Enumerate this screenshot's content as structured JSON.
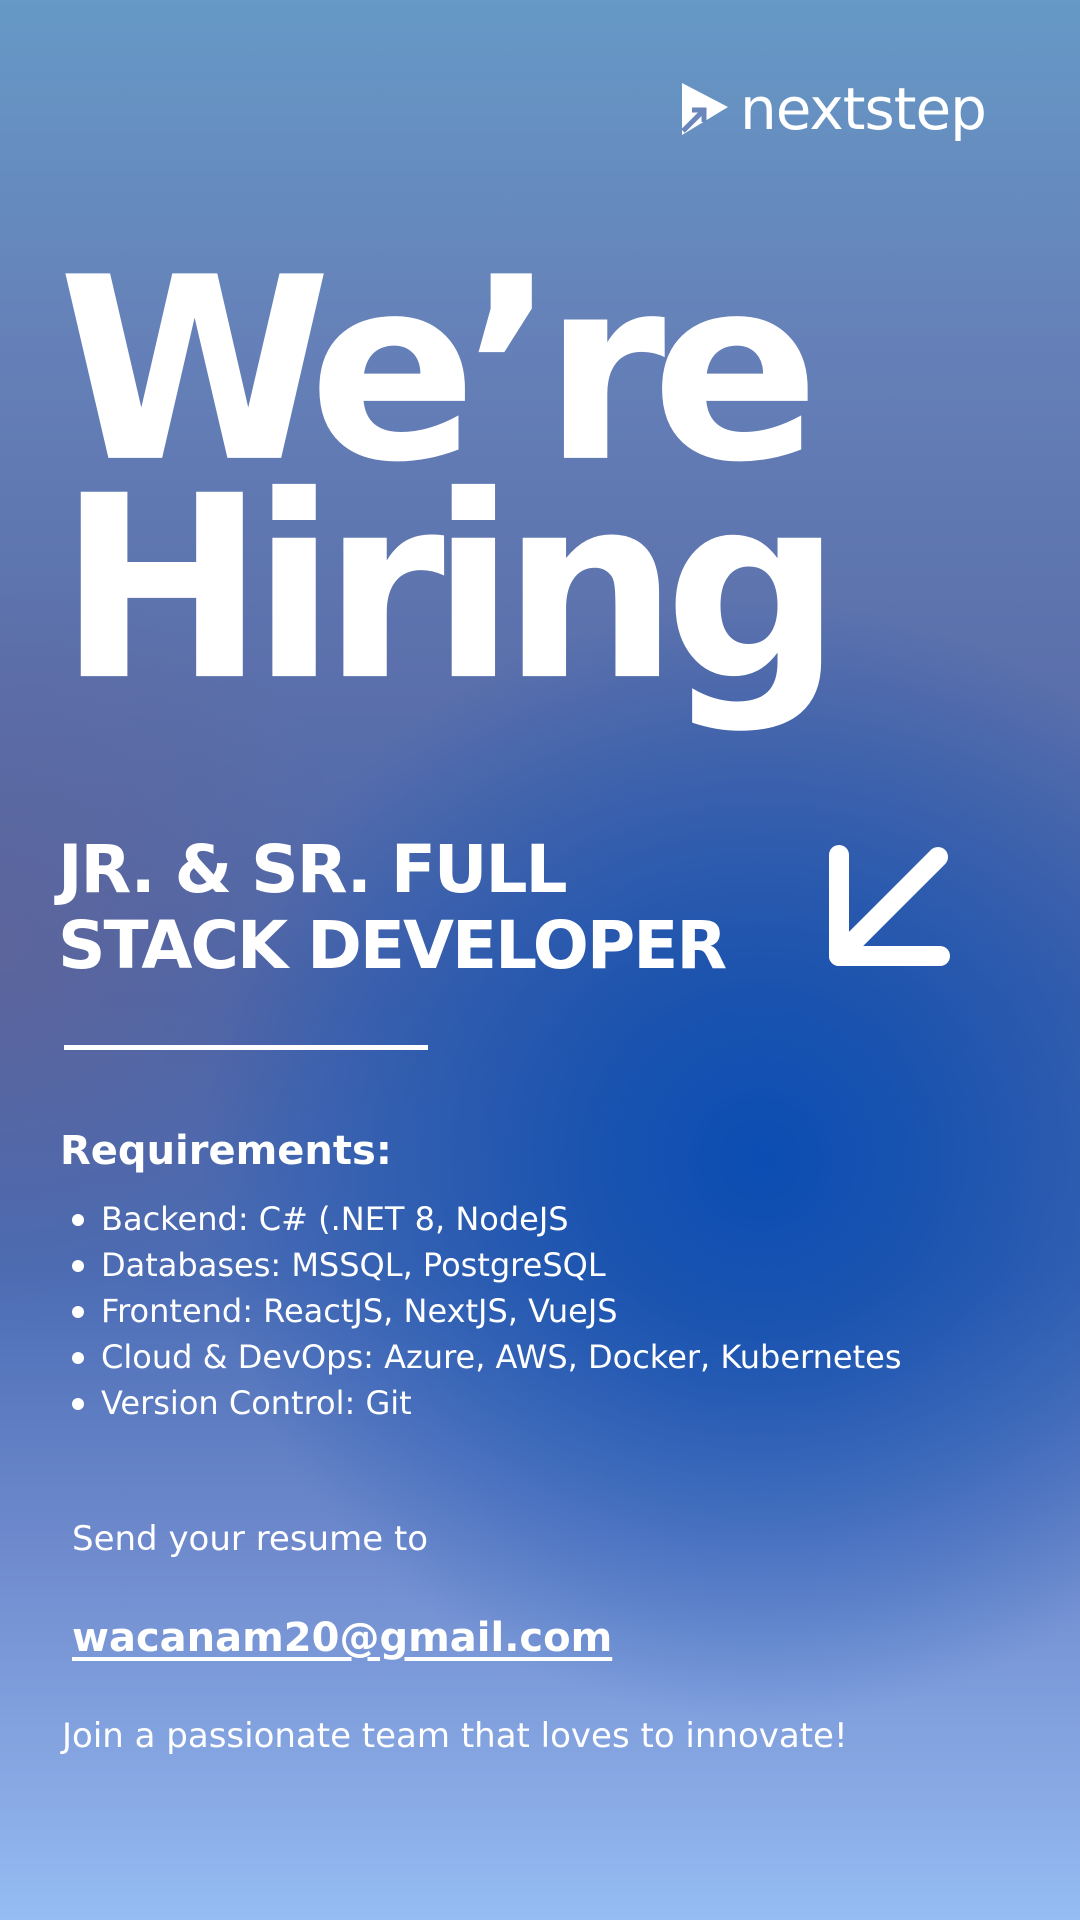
{
  "brand": {
    "name": "nextstep",
    "logo_icon": "paper-plane-arrow-icon"
  },
  "headline": {
    "line1": "We’re",
    "line2": "Hiring"
  },
  "job_title": {
    "line1": "JR. & SR. FULL",
    "line2": "STACK DEVELOPER",
    "arrow_icon": "arrow-down-left-icon"
  },
  "requirements": {
    "heading": "Requirements:",
    "items": [
      "Backend: C# (.NET 8, NodeJS",
      "Databases: MSSQL, PostgreSQL",
      "Frontend: ReactJS, NextJS, VueJS",
      "Cloud & DevOps: Azure, AWS, Docker, Kubernetes",
      "Version Control: Git"
    ]
  },
  "contact": {
    "send_text": "Send your resume to",
    "email": "wacanam20@gmail.com"
  },
  "tagline": "Join a passionate team that loves to innovate!",
  "colors": {
    "text": "#ffffff",
    "background_top": "#6699c6",
    "background_mid": "#4a66ac",
    "accent_glow": "#0b4db3",
    "background_bottom": "#96bdf4"
  }
}
